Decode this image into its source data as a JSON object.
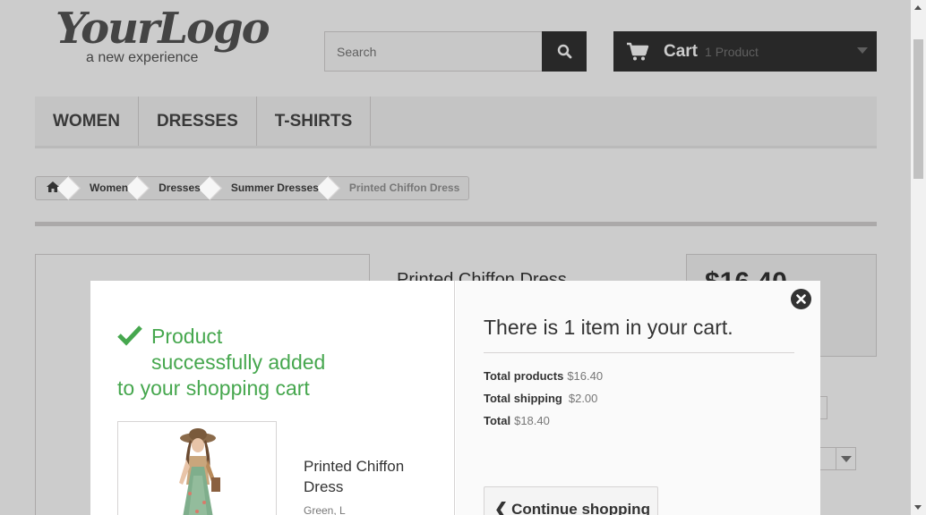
{
  "header": {
    "logo_script": "YourLogo",
    "logo_tagline": "a new experience",
    "search_placeholder": "Search",
    "cart_label": "Cart",
    "cart_count": "1 Product"
  },
  "menu": {
    "items": [
      {
        "label": "WOMEN"
      },
      {
        "label": "DRESSES"
      },
      {
        "label": "T-SHIRTS"
      }
    ]
  },
  "breadcrumb": {
    "items": [
      {
        "label": "Women"
      },
      {
        "label": "Dresses"
      },
      {
        "label": "Summer Dresses"
      }
    ],
    "current": "Printed Chiffon Dress"
  },
  "background_product": {
    "title": "Printed Chiffon Dress",
    "price": "$16.40"
  },
  "modal": {
    "success_line1": "Product",
    "success_line2": "successfully added",
    "success_line3": "to your shopping cart",
    "product_name": "Printed Chiffon Dress",
    "product_attributes": "Green, L",
    "cart_heading": "There is 1 item in your cart.",
    "total_products_label": "Total products",
    "total_products_value": "$16.40",
    "total_shipping_label": "Total shipping",
    "total_shipping_value": "$2.00",
    "total_label": "Total",
    "total_value": "$18.40",
    "continue_label": "Continue shopping"
  },
  "colors": {
    "success_green": "#46a74e",
    "dark": "#333333",
    "border": "#d6d4d4"
  },
  "icons": [
    "home-icon",
    "search-icon",
    "cart-icon",
    "checkmark-icon",
    "close-icon",
    "chevron-left-icon"
  ]
}
